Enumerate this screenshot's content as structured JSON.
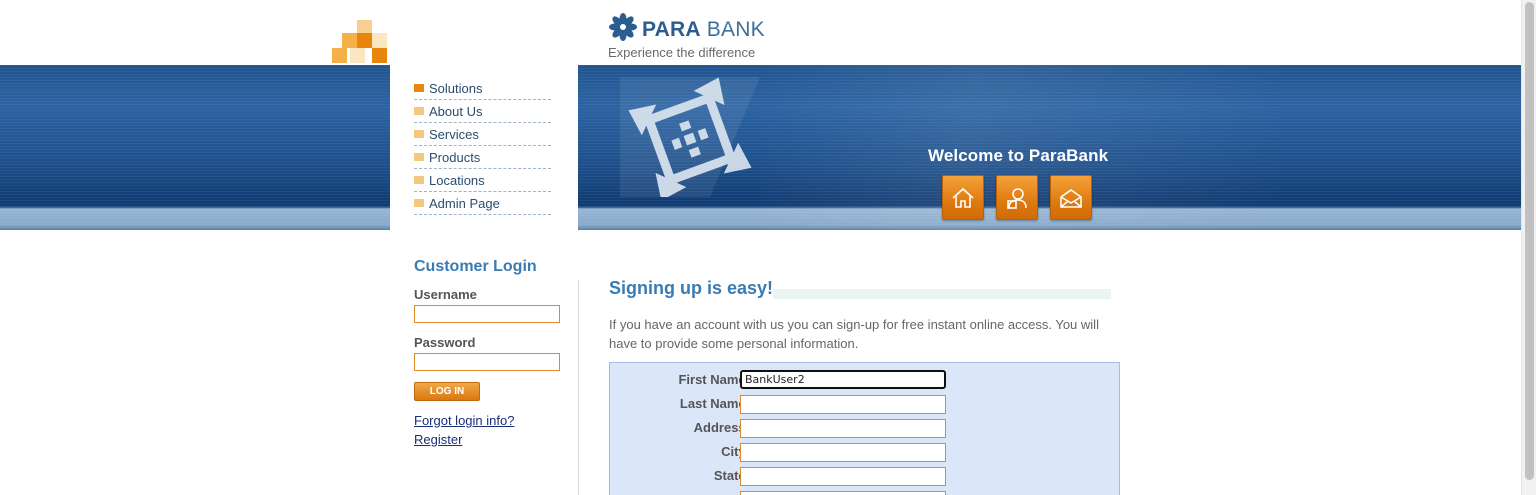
{
  "header": {
    "logo_text_bold": "PARA",
    "logo_text_light": " BANK",
    "caption": "Experience the difference",
    "welcome": "Welcome to ParaBank",
    "icons": [
      "home-icon",
      "about-icon",
      "contact-icon"
    ]
  },
  "menu": {
    "items": [
      {
        "label": "Solutions",
        "color": "#e8850c"
      },
      {
        "label": "About Us",
        "color": "#f5c880"
      },
      {
        "label": "Services",
        "color": "#f5c880"
      },
      {
        "label": "Products",
        "color": "#f5c880"
      },
      {
        "label": "Locations",
        "color": "#f5c880"
      },
      {
        "label": "Admin Page",
        "color": "#f5c880"
      }
    ]
  },
  "login": {
    "title": "Customer Login",
    "username_label": "Username",
    "username_value": "",
    "password_label": "Password",
    "password_value": "",
    "button_label": "LOG IN",
    "forgot_link": "Forgot login info?",
    "register_link": "Register"
  },
  "main": {
    "title": "Signing up is easy!",
    "intro": "If you have an account with us you can sign-up for free instant online access. You will have to provide some personal information.",
    "fields": [
      {
        "label": "First Name:",
        "value": "BankUser2"
      },
      {
        "label": "Last Name:",
        "value": ""
      },
      {
        "label": "Address:",
        "value": ""
      },
      {
        "label": "City:",
        "value": ""
      },
      {
        "label": "State:",
        "value": ""
      }
    ]
  },
  "colors": {
    "accent_orange": "#e8850c",
    "title_blue": "#3a7bb1",
    "banner_blue": "#21548f"
  }
}
